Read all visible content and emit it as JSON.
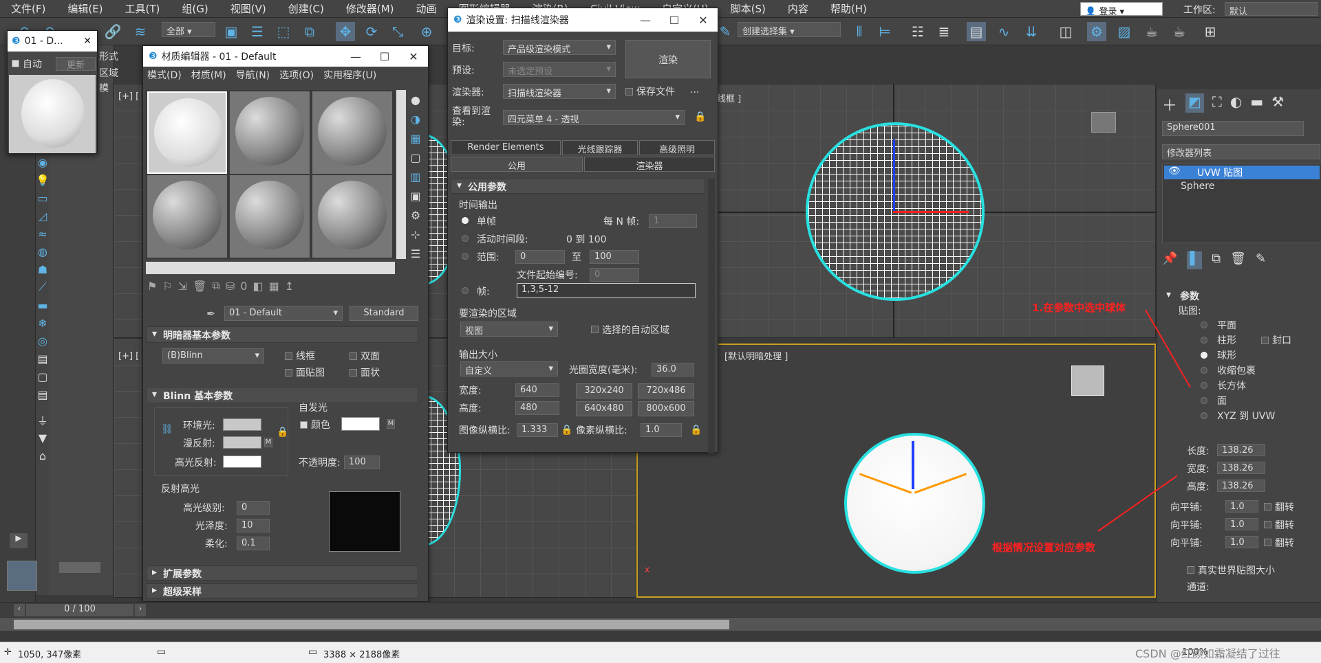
{
  "menubar": {
    "items": [
      "文件(F)",
      "编辑(E)",
      "工具(T)",
      "组(G)",
      "视图(V)",
      "创建(C)",
      "修改器(M)",
      "动画",
      "图形编辑器",
      "渲染(R)",
      "Civil View",
      "自定义(U)",
      "脚本(S)",
      "内容",
      "帮助(H)"
    ],
    "login": "登录",
    "workspace_label": "工作区:",
    "workspace_value": "默认"
  },
  "toolbar": {
    "filter": "全部",
    "selection_set": "创建选择集"
  },
  "small_window": {
    "title": "01 - D...",
    "auto_label": "自动",
    "update_label": "更新"
  },
  "left_strip": {
    "labels": [
      "形式",
      "区域",
      "模"
    ]
  },
  "material_editor": {
    "title": "材质编辑器 - 01 - Default",
    "menu": [
      "模式(D)",
      "材质(M)",
      "导航(N)",
      "选项(O)",
      "实用程序(U)"
    ],
    "material_name": "01 - Default",
    "material_type": "Standard",
    "shader_section": "明暗器基本参数",
    "shader": "(B)Blinn",
    "wire": "线框",
    "two_sided": "双面",
    "face_map": "面贴图",
    "faceted": "面状",
    "blinn_section": "Blinn 基本参数",
    "self_illum": "自发光",
    "color_label": "颜色",
    "ambient": "环境光:",
    "diffuse": "漫反射:",
    "specular": "高光反射:",
    "opacity_label": "不透明度:",
    "opacity_value": "100",
    "spec_highlights": "反射高光",
    "spec_level_label": "高光级别:",
    "spec_level": "0",
    "gloss_label": "光泽度:",
    "gloss": "10",
    "soften_label": "柔化:",
    "soften": "0.1",
    "extended": "扩展参数",
    "supersampling": "超级采样",
    "m_label": "M"
  },
  "render_setup": {
    "title": "渲染设置: 扫描线渲染器",
    "target_label": "目标:",
    "target": "产品级渲染模式",
    "preset_label": "预设:",
    "preset": "未选定预设",
    "renderer_label": "渲染器:",
    "renderer": "扫描线渲染器",
    "save_file": "保存文件",
    "view_label": "查看到渲染:",
    "view": "四元菜单 4 - 透视",
    "render_btn": "渲染",
    "dots": "...",
    "tabs": [
      "Render Elements",
      "光线跟踪器",
      "高级照明",
      "公用",
      "渲染器"
    ],
    "common_params": "公用参数",
    "time_output": "时间输出",
    "single": "单帧",
    "every_n": "每 N 帧:",
    "every_n_val": "1",
    "active_seg": "活动时间段:",
    "active_range": "0 到 100",
    "range": "范围:",
    "range_from": "0",
    "to": "至",
    "range_to": "100",
    "file_num": "文件起始编号:",
    "file_num_val": "0",
    "frames": "帧:",
    "frames_val": "1,3,5-12",
    "area": "要渲染的区域",
    "area_val": "视图",
    "auto_region": "选择的自动区域",
    "output_size": "输出大小",
    "size_preset": "自定义",
    "aperture": "光圈宽度(毫米):",
    "aperture_val": "36.0",
    "width_label": "宽度:",
    "width": "640",
    "height_label": "高度:",
    "height": "480",
    "presets": [
      "320x240",
      "720x486",
      "640x480",
      "800x600"
    ],
    "img_aspect": "图像纵横比:",
    "img_aspect_val": "1.333",
    "pix_aspect": "像素纵横比:",
    "pix_aspect_val": "1.0"
  },
  "viewports": {
    "top_label": "线框 ]",
    "persp_label": "[默认明暗处理 ]",
    "tl_label": "[+] [",
    "bl_label": "[+] ["
  },
  "command_panel": {
    "object_name": "Sphere001",
    "modifier_list": "修改器列表",
    "stack": [
      "UVW 贴图",
      "Sphere"
    ],
    "params": "参数",
    "mapping": "贴图:",
    "options": [
      "平面",
      "柱形",
      "球形",
      "收缩包裹",
      "长方体",
      "面",
      "XYZ 到 UVW"
    ],
    "cap": "封口",
    "length_label": "长度:",
    "length": "138.26",
    "width_label": "宽度:",
    "width": "138.26",
    "height_label": "高度:",
    "height": "138.26",
    "tile_label": "向平铺:",
    "tile": "1.0",
    "flip": "翻转",
    "real_world": "真实世界贴图大小",
    "channel": "通道:"
  },
  "annotations": {
    "note1": "1.在参数中选中球体",
    "note2": "根据情况设置对应参数"
  },
  "timeline": {
    "frame": "0 / 100"
  },
  "statusbar": {
    "coords": "1050, 347像素",
    "size": "3388 × 2188像素",
    "zoom": "100%",
    "watermark": "CSDN @红颜如霜凝结了过往"
  },
  "colors": {
    "accent": "#5fb3e6",
    "annotation": "#ff2020",
    "highlight": "#3b82d6"
  }
}
